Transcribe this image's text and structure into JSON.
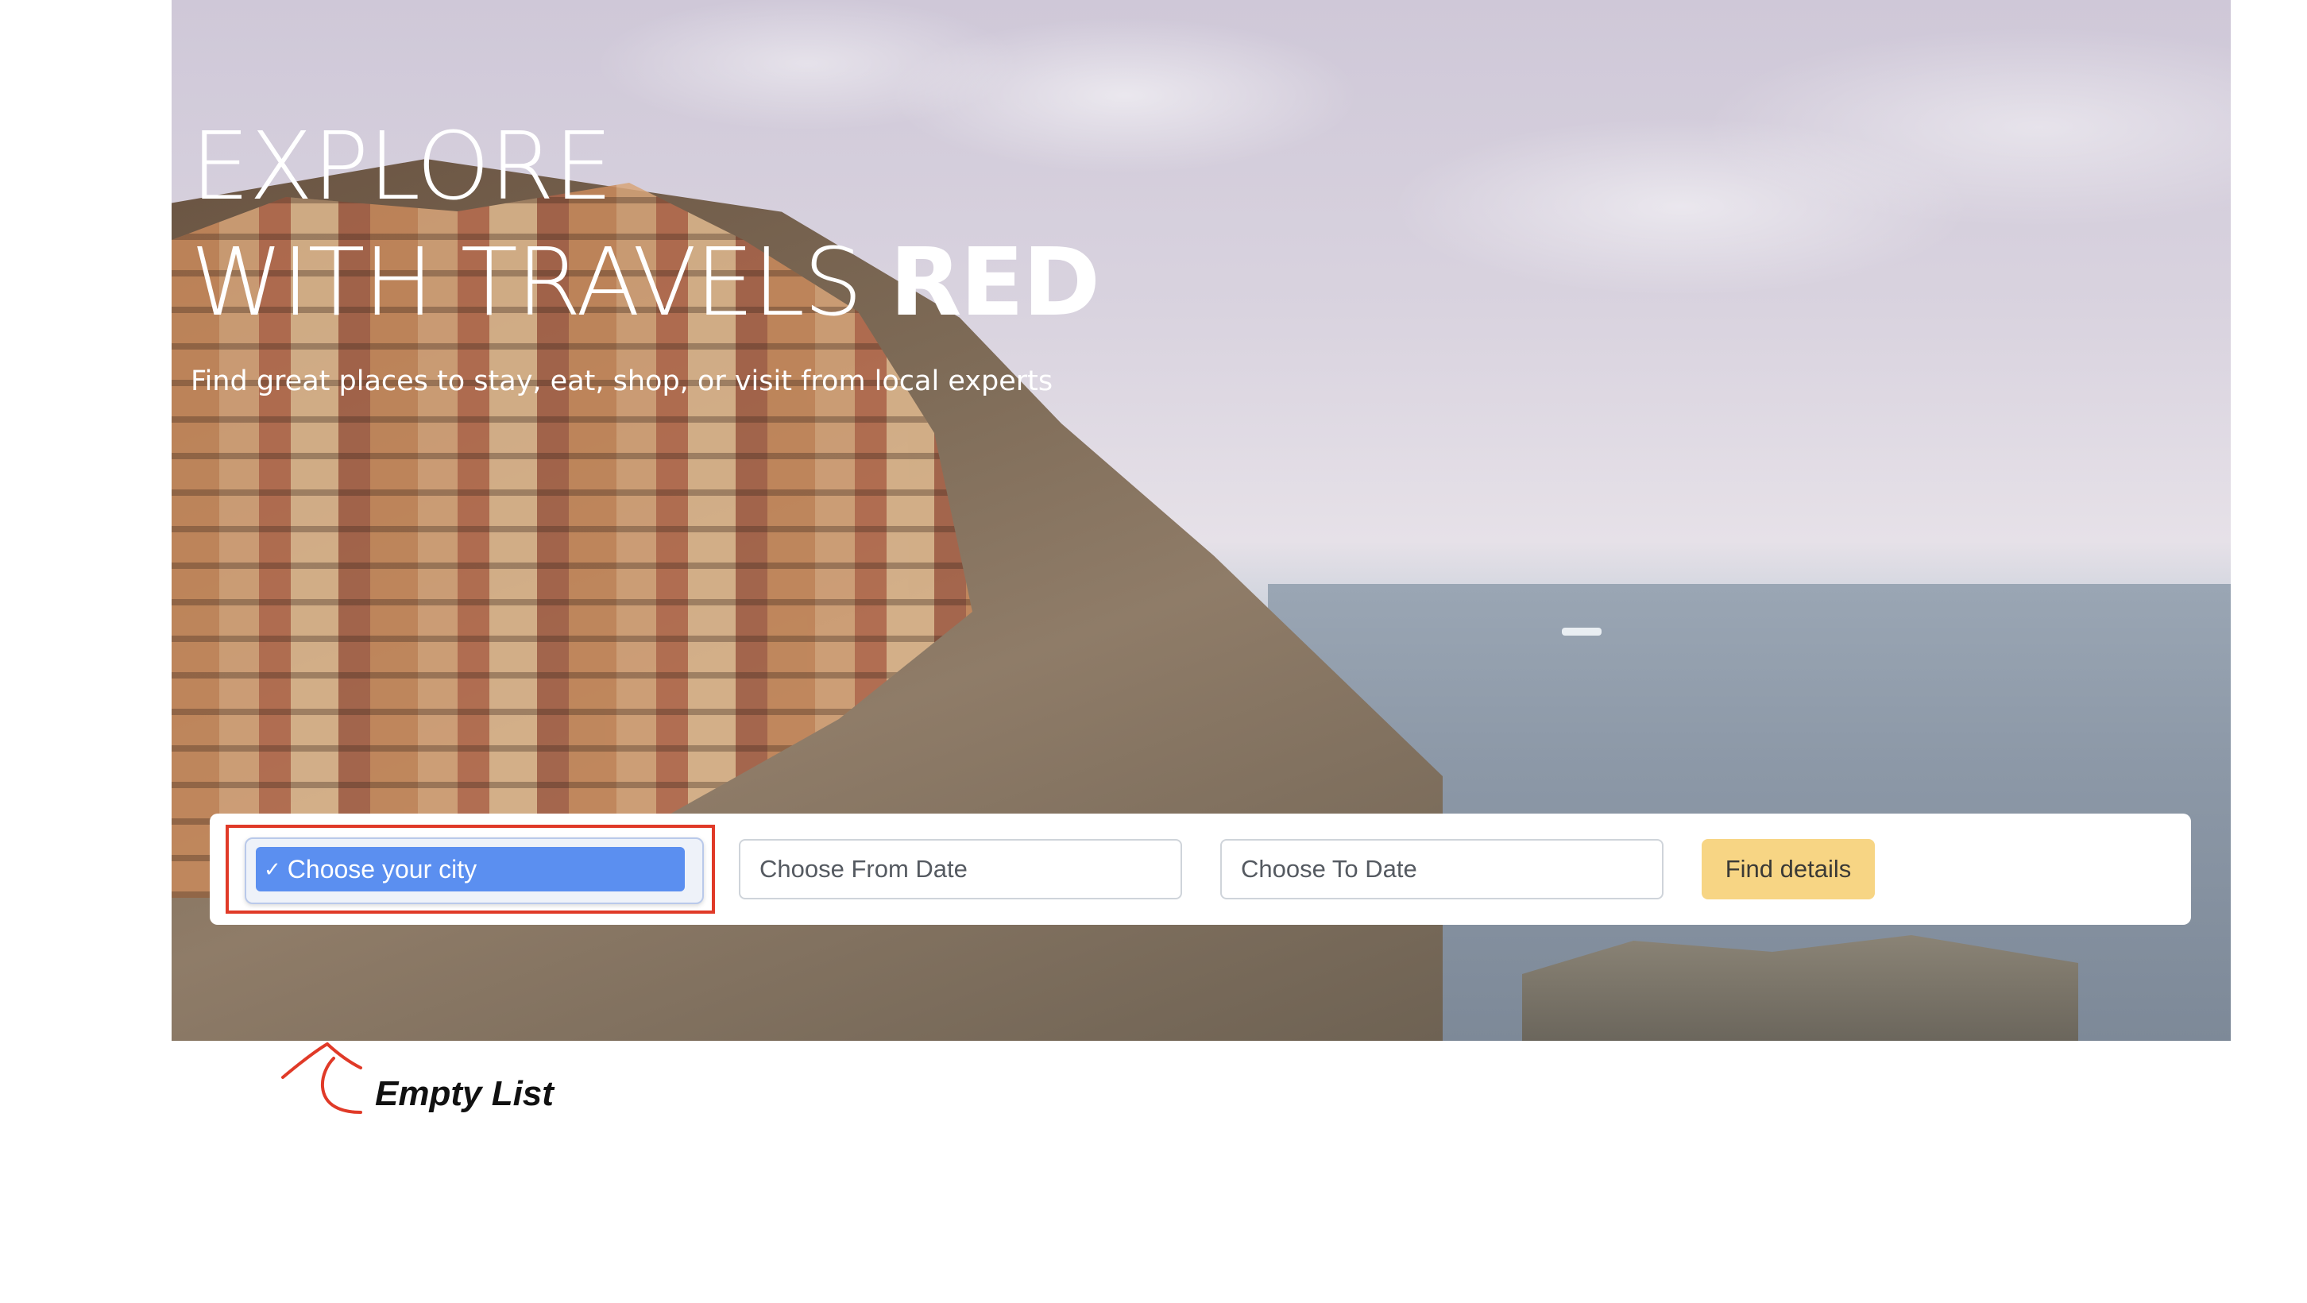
{
  "hero": {
    "title_line1": "EXPLORE",
    "title_line2_prefix": "WITH TRAVELS ",
    "title_line2_brand": "RED",
    "tagline": "Find great places to stay, eat, shop, or visit from local experts"
  },
  "search": {
    "city_select": {
      "selected_label": "Choose your city",
      "selected_mark": "✓"
    },
    "from_date": {
      "placeholder": "Choose From Date"
    },
    "to_date": {
      "placeholder": "Choose To Date"
    },
    "submit_label": "Find details"
  },
  "annotation": {
    "label": "Empty List",
    "highlight_color": "#e03a28"
  },
  "colors": {
    "option_highlight": "#5b8ff0",
    "button_bg": "#f7d584"
  }
}
